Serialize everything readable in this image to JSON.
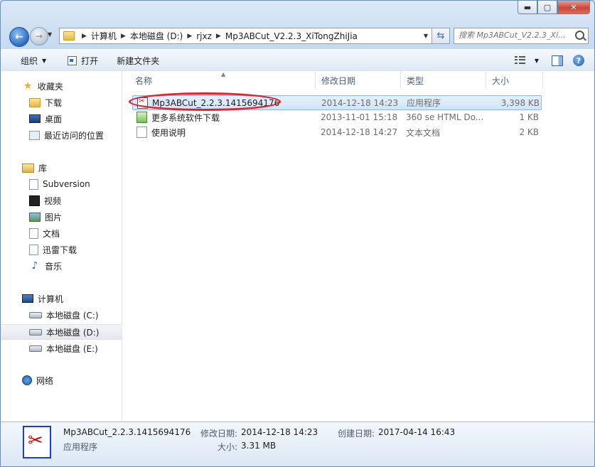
{
  "window": {
    "minimize_glyph": "▬",
    "maximize_glyph": "▢",
    "close_glyph": "✕"
  },
  "address": {
    "crumbs": [
      "计算机",
      "本地磁盘 (D:)",
      "rjxz",
      "Mp3ABCut_V2.2.3_XiTongZhiJia"
    ]
  },
  "search": {
    "placeholder": "搜索 Mp3ABCut_V2.2.3_Xi..."
  },
  "toolbar": {
    "organize": "组织",
    "open": "打开",
    "new_folder": "新建文件夹"
  },
  "nav": {
    "favorites": "收藏夹",
    "downloads": "下载",
    "desktop": "桌面",
    "recent": "最近访问的位置",
    "libraries": "库",
    "subversion": "Subversion",
    "videos": "视频",
    "pictures": "图片",
    "documents": "文档",
    "thunder": "迅雷下载",
    "music": "音乐",
    "computer": "计算机",
    "drive_c": "本地磁盘 (C:)",
    "drive_d": "本地磁盘 (D:)",
    "drive_e": "本地磁盘 (E:)",
    "network": "网络"
  },
  "columns": {
    "name": "名称",
    "date": "修改日期",
    "type": "类型",
    "size": "大小"
  },
  "files": [
    {
      "name": "Mp3ABCut_2.2.3.1415694176",
      "date": "2014-12-18 14:23",
      "type": "应用程序",
      "size": "3,398 KB",
      "icon": "scissors-exe-icon"
    },
    {
      "name": "更多系统软件下载",
      "date": "2013-11-01 15:18",
      "type": "360 se HTML Do...",
      "size": "1 KB",
      "icon": "html-file-icon"
    },
    {
      "name": "使用说明",
      "date": "2014-12-18 14:27",
      "type": "文本文档",
      "size": "2 KB",
      "icon": "text-file-icon"
    }
  ],
  "details": {
    "name": "Mp3ABCut_2.2.3.1415694176",
    "type": "应用程序",
    "modified_label": "修改日期:",
    "modified": "2014-12-18 14:23",
    "created_label": "创建日期:",
    "created": "2017-04-14 16:43",
    "size_label": "大小:",
    "size": "3.31 MB"
  },
  "colors": {
    "highlight_ring": "#e8202a",
    "selection": "#cfe4fa"
  }
}
